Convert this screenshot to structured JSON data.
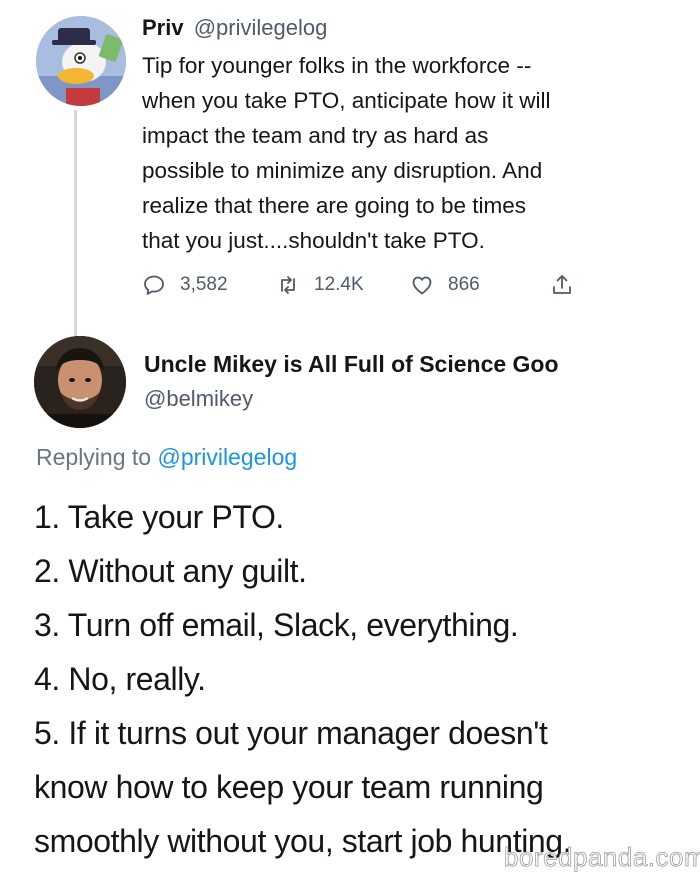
{
  "tweet1": {
    "name": "Priv",
    "handle": "@privilegelog",
    "lines": [
      "Tip for younger folks in the workforce --",
      "when you take PTO, anticipate how it will",
      "impact the team and try as hard as",
      "possible to minimize any disruption. And",
      "realize that there are going to be times",
      "that you just....shouldn't take PTO."
    ],
    "stats": {
      "replies": "3,582",
      "retweets": "12.4K",
      "likes": "866"
    },
    "icons": [
      "reply-icon",
      "retweet-icon",
      "like-icon",
      "share-icon"
    ]
  },
  "tweet2": {
    "name": "Uncle Mikey is All Full of Science Goo",
    "handle": "@belmikey",
    "replying_prefix": "Replying to ",
    "replying_to": "@privilegelog",
    "lines": [
      "1. Take your PTO.",
      "2. Without any guilt.",
      "3. Turn off email, Slack, everything.",
      "4. No, really.",
      "5. If it turns out your manager doesn't",
      "know how to keep your team running",
      "smoothly without you, start job hunting."
    ]
  },
  "watermark": "boredpanda.com",
  "colors": {
    "text": "#14171a",
    "muted": "#4f5b66",
    "link": "#1b95e0",
    "thread_line": "#cfd9de"
  }
}
